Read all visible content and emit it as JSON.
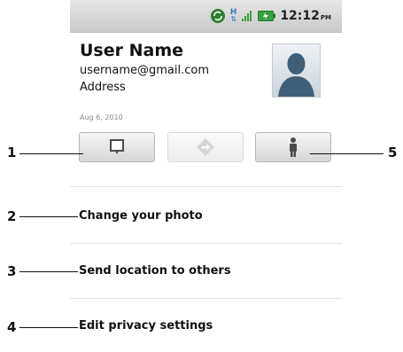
{
  "status_bar": {
    "time": "12:12",
    "ampm": "PM",
    "icons": [
      "sync-icon",
      "data-transfer-icon",
      "signal-icon",
      "battery-icon"
    ],
    "data_label": "H"
  },
  "profile": {
    "name": "User Name",
    "email": "username@gmail.com",
    "address": "Address",
    "date": "Aug 6, 2010"
  },
  "action_buttons": [
    {
      "icon": "message-icon",
      "enabled": true
    },
    {
      "icon": "directions-icon",
      "enabled": false
    },
    {
      "icon": "person-icon",
      "enabled": true
    }
  ],
  "menu": {
    "items": [
      {
        "label": "Change your photo"
      },
      {
        "label": "Send location to others"
      },
      {
        "label": "Edit privacy settings"
      }
    ]
  },
  "callouts": [
    "1",
    "2",
    "3",
    "4",
    "5"
  ]
}
